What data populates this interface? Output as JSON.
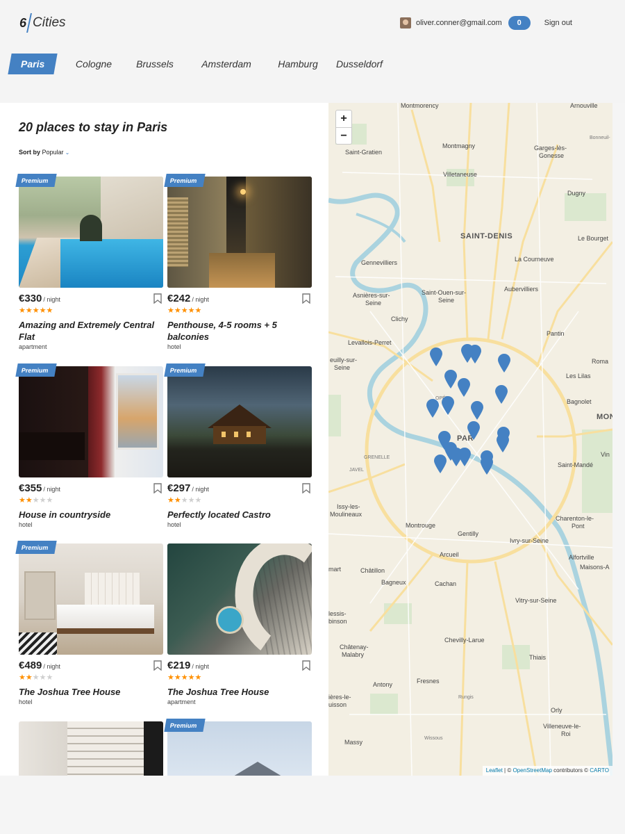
{
  "header": {
    "logo_number": "6",
    "logo_word": "Cities",
    "user_email": "oliver.conner@gmail.com",
    "favorites_count": "0",
    "sign_out": "Sign out"
  },
  "tabs": [
    {
      "label": "Paris",
      "active": true
    },
    {
      "label": "Cologne",
      "active": false
    },
    {
      "label": "Brussels",
      "active": false
    },
    {
      "label": "Amsterdam",
      "active": false
    },
    {
      "label": "Hamburg",
      "active": false
    },
    {
      "label": "Dusseldorf",
      "active": false
    }
  ],
  "places": {
    "title": "20 places to stay in Paris",
    "sort_label": "Sort by",
    "sort_value": "Popular",
    "premium_label": "Premium",
    "per_night": "/ night",
    "offers": [
      {
        "price": "€330",
        "rating": 5,
        "name": "Amazing and Extremely Central Flat",
        "type": "apartment",
        "premium": true
      },
      {
        "price": "€242",
        "rating": 5,
        "name": "Penthouse, 4-5 rooms + 5 balconies",
        "type": "hotel",
        "premium": true
      },
      {
        "price": "€355",
        "rating": 2,
        "name": "House in countryside",
        "type": "hotel",
        "premium": true
      },
      {
        "price": "€297",
        "rating": 2,
        "name": "Perfectly located Castro",
        "type": "hotel",
        "premium": true
      },
      {
        "price": "€489",
        "rating": 2,
        "name": "The Joshua Tree House",
        "type": "hotel",
        "premium": true
      },
      {
        "price": "€219",
        "rating": 5,
        "name": "The Joshua Tree House",
        "type": "apartment",
        "premium": false
      },
      {
        "premium": false
      },
      {
        "premium": true
      }
    ]
  },
  "map": {
    "zoom_in": "+",
    "zoom_out": "−",
    "labels": {
      "montmorency": "Montmorency",
      "arnouville": "Arnouville",
      "bonneuil": "Bonneuil-",
      "montmagny": "Montmagny",
      "garges": "Garges-lès-",
      "gonesse": "Gonesse",
      "saint_gratien": "Saint-Gratien",
      "villetaneuse": "Villetaneuse",
      "dugny": "Dugny",
      "saint_denis": "SAINT-DENIS",
      "le_bourget": "Le Bourget",
      "gennevilliers": "Gennevilliers",
      "la_courneuve": "La Courneuve",
      "asnieres_1": "Asnières-sur-",
      "asnieres_2": "Seine",
      "saint_ouen_1": "Saint-Ouen-sur-",
      "saint_ouen_2": "Seine",
      "aubervilliers": "Aubervilliers",
      "clichy": "Clichy",
      "pantin": "Pantin",
      "levallois": "Levallois-Perret",
      "neuilly_1": "euilly-sur-",
      "neuilly_2": "Seine",
      "roma": "Roma",
      "les_lilas": "Les Lilas",
      "opera": "OPÉR",
      "bagnolet": "Bagnolet",
      "mon": "MON",
      "paris": "PAR",
      "grenelle": "GRENELLE",
      "javel": "JAVEL",
      "vin": "Vin",
      "saint_mande": "Saint-Mandé",
      "issy_1": "Issy-les-",
      "issy_2": "Moulineaux",
      "montrouge": "Montrouge",
      "gentilly": "Gentilly",
      "charenton_1": "Charenton-le-",
      "charenton_2": "Pont",
      "ivry": "Ivry-sur-Seine",
      "arcueil": "Arcueil",
      "alfortville_1": "Alfortville",
      "alfortville_2": "Maisons-A",
      "clamart": "mart",
      "chatillon": "Châtillon",
      "bagneux": "Bagneux",
      "cachan": "Cachan",
      "vitry": "Vitry-sur-Seine",
      "plessis_1": "lessis-",
      "plessis_2": "binson",
      "chevilly": "Chevilly-Larue",
      "chatenay_1": "Châtenay-",
      "chatenay_2": "Malabry",
      "thiais": "Thiais",
      "antony": "Antony",
      "fresnes": "Fresnes",
      "rungis": "Rungis",
      "verrieres_1": "ières-le-",
      "verrieres_2": "uisson",
      "orly": "Orly",
      "villeneuve_1": "Villeneuve-le-",
      "villeneuve_2": "Roi",
      "wissous": "Wissous",
      "massy": "Massy"
    },
    "attribution": {
      "leaflet": "Leaflet",
      "sep": " | © ",
      "osm": "OpenStreetMap",
      "contributors": " contributors © ",
      "carto": "CARTO"
    },
    "pin_color": "#4481c3"
  },
  "colors": {
    "accent": "#4481c3",
    "star": "#ff9000",
    "star_off": "#cfcfcf"
  }
}
